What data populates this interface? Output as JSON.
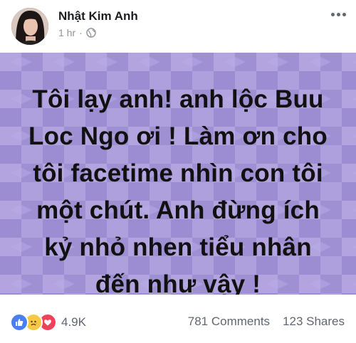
{
  "post": {
    "author": "Nhật Kim Anh",
    "time": "1 hr",
    "separator": "·",
    "text_lines": [
      "Tôi lạy anh!  anh lộc Buu",
      "Loc Ngo ơi ! Làm ơn cho",
      "tôi facetime nhìn con tôi",
      "một chút. Anh đừng ích",
      "kỷ nhỏ nhen tiểu nhân",
      "đến như vậy !"
    ],
    "background_color": "#a999d9",
    "text_color": "#111111"
  },
  "footer": {
    "reaction_count": "4.9K",
    "reactions": [
      "like-icon",
      "sad-icon",
      "love-icon"
    ],
    "comments": "781 Comments",
    "shares": "123 Shares"
  }
}
